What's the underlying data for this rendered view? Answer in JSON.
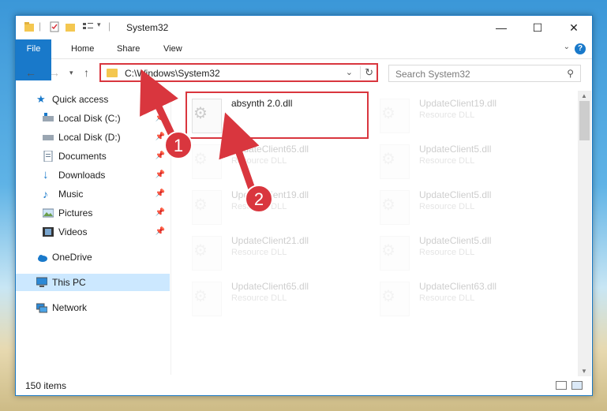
{
  "window": {
    "title": "System32",
    "minimize": "—",
    "maximize": "☐",
    "close": "✕"
  },
  "ribbon": {
    "tabs": [
      "File",
      "Home",
      "Share",
      "View"
    ],
    "help": "?"
  },
  "address": {
    "path": "C:\\Windows\\System32",
    "search_placeholder": "Search System32"
  },
  "nav": {
    "items": [
      {
        "label": "Quick access",
        "icon": "star-icon"
      },
      {
        "label": "Local Disk (C:)",
        "icon": "drive-icon"
      },
      {
        "label": "Local Disk (D:)",
        "icon": "drive-icon"
      },
      {
        "label": "Documents",
        "icon": "documents-icon"
      },
      {
        "label": "Downloads",
        "icon": "download-icon"
      },
      {
        "label": "Music",
        "icon": "music-icon"
      },
      {
        "label": "Pictures",
        "icon": "pictures-icon"
      },
      {
        "label": "Videos",
        "icon": "videos-icon"
      },
      {
        "label": "OneDrive",
        "icon": "cloud-icon"
      },
      {
        "label": "This PC",
        "icon": "pc-icon"
      },
      {
        "label": "Network",
        "icon": "network-icon"
      }
    ]
  },
  "files": [
    {
      "name": "absynth 2.0.dll",
      "type": ""
    },
    {
      "name": "UpdateClient19.dll",
      "type": "Resource DLL"
    },
    {
      "name": "UpdateClient65.dll",
      "type": "Resource DLL"
    },
    {
      "name": "UpdateClient5.dll",
      "type": "Resource DLL"
    },
    {
      "name": "UpdateClient19.dll",
      "type": "Resource DLL"
    },
    {
      "name": "UpdateClient5.dll",
      "type": "Resource DLL"
    },
    {
      "name": "UpdateClient21.dll",
      "type": "Resource DLL"
    },
    {
      "name": "UpdateClient5.dll",
      "type": "Resource DLL"
    },
    {
      "name": "UpdateClient65.dll",
      "type": "Resource DLL"
    },
    {
      "name": "UpdateClient63.dll",
      "type": "Resource DLL"
    }
  ],
  "status": {
    "count": "150 items"
  },
  "annotations": {
    "step1": "1",
    "step2": "2",
    "color": "#d9363e"
  }
}
